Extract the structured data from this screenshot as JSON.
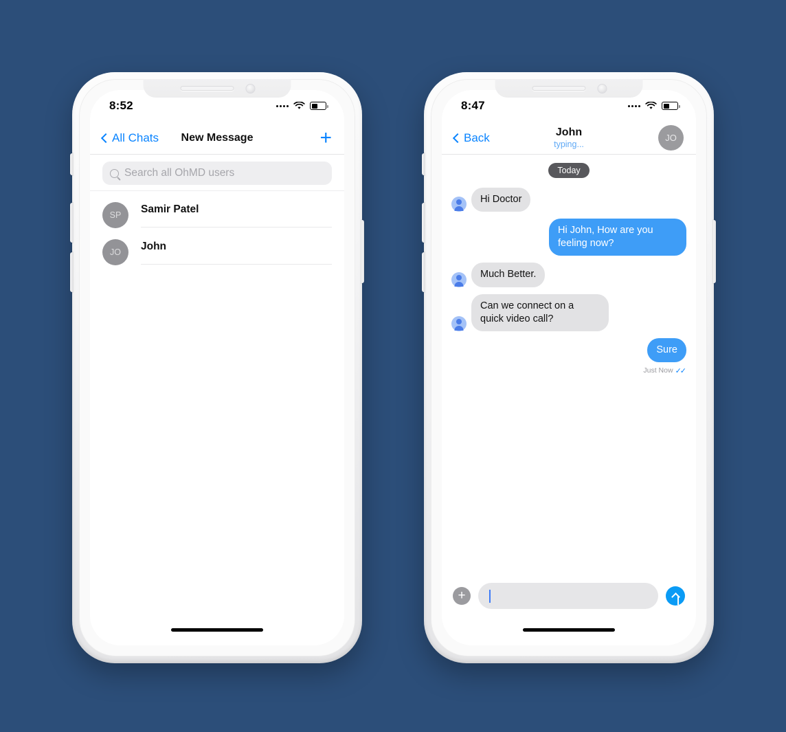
{
  "background_color": "#2c4e79",
  "accent_color": "#0a84ff",
  "bubble_out_color": "#3e9df7",
  "phones": {
    "left": {
      "status": {
        "time": "8:52",
        "signal_icon": "signal-dots-icon",
        "wifi_icon": "wifi-icon",
        "battery_icon": "battery-icon",
        "battery_level": "45%"
      },
      "navbar": {
        "back_label": "All Chats",
        "title": "New Message",
        "add_label": "+"
      },
      "search": {
        "placeholder": "Search all OhMD users",
        "value": "",
        "icon": "search-icon"
      },
      "contacts": [
        {
          "initials": "SP",
          "name": "Samir Patel"
        },
        {
          "initials": "JO",
          "name": "John"
        }
      ]
    },
    "right": {
      "status": {
        "time": "8:47",
        "signal_icon": "signal-dots-icon",
        "wifi_icon": "wifi-icon",
        "battery_icon": "battery-icon",
        "battery_level": "45%"
      },
      "navbar": {
        "back_label": "Back",
        "title": "John",
        "subtitle": "typing...",
        "avatar_initials": "JO"
      },
      "chat": {
        "day_divider": "Today",
        "messages": [
          {
            "direction": "in",
            "text": "Hi Doctor",
            "avatar": "person-icon"
          },
          {
            "direction": "out",
            "text": "Hi John, How are you feeling now?"
          },
          {
            "direction": "in",
            "text": "Much Better.",
            "avatar": "person-icon"
          },
          {
            "direction": "in",
            "text": "Can we connect on a quick video call?",
            "avatar": "person-icon"
          },
          {
            "direction": "out",
            "text": "Sure",
            "receipt_time": "Just Now",
            "receipt_ticks": "✓✓"
          }
        ]
      },
      "composer": {
        "attach_label": "+",
        "input_value": "",
        "placeholder": "",
        "send_icon": "send-arrow-icon"
      }
    }
  }
}
